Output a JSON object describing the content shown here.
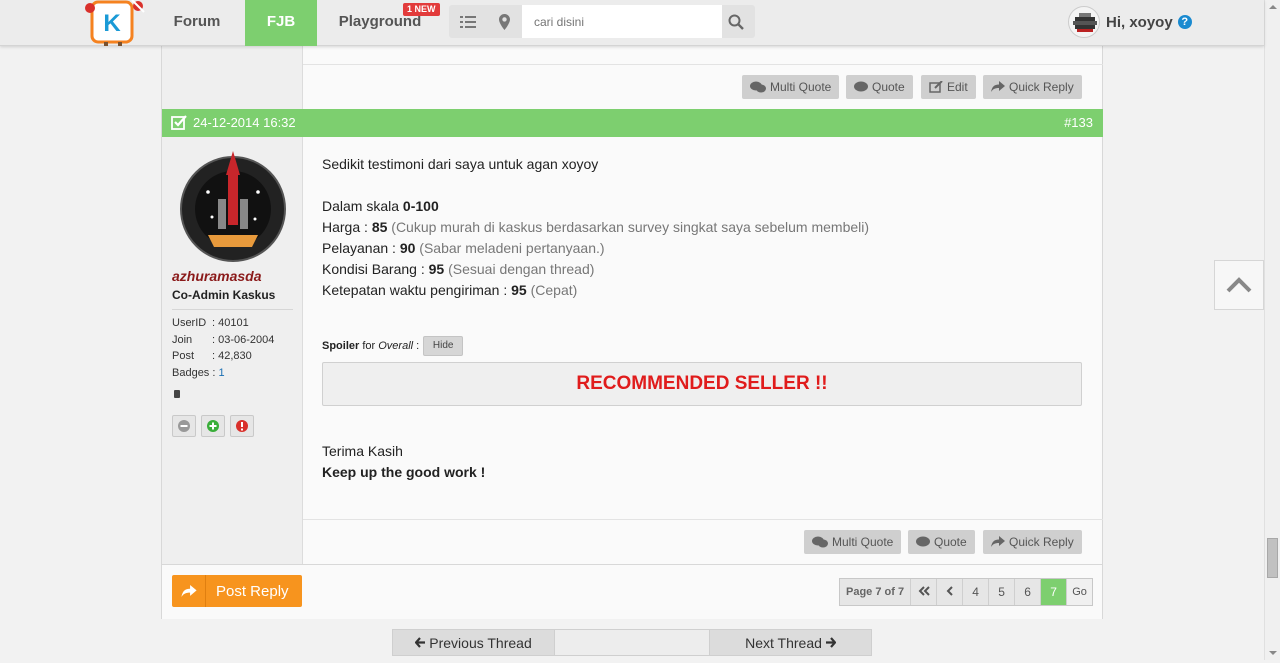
{
  "nav": {
    "forum": "Forum",
    "fjb": "FJB",
    "playground": "Playground",
    "new_badge": "1 NEW"
  },
  "search": {
    "placeholder": "cari disini"
  },
  "user": {
    "greeting": "Hi, xoyoy",
    "help": "?"
  },
  "prev_post": {
    "buttons": {
      "multi_quote": "Multi Quote",
      "quote": "Quote",
      "edit": "Edit",
      "quick_reply": "Quick Reply"
    }
  },
  "post": {
    "date": "24-12-2014 16:32",
    "number": "#133",
    "author": {
      "name": "azhuramasda",
      "rank": "Co-Admin Kaskus",
      "userid_label": "UserID",
      "userid": ": 40101",
      "join_label": "Join",
      "join": ": 03-06-2004",
      "post_label": "Post",
      "post_count": ": 42,830",
      "badges_label": "Badges :",
      "badges": "1"
    },
    "body": {
      "intro": "Sedikit testimoni dari saya untuk agan xoyoy",
      "scale_label": "Dalam skala ",
      "scale_value": "0-100",
      "harga_label": "Harga : ",
      "harga_value": "85",
      "harga_note": " (Cukup murah di kaskus berdasarkan survey singkat saya sebelum membeli)",
      "pelayanan_label": "Pelayanan : ",
      "pelayanan_value": "90",
      "pelayanan_note": " (Sabar meladeni pertanyaan.)",
      "kondisi_label": "Kondisi Barang : ",
      "kondisi_value": "95",
      "kondisi_note": " (Sesuai dengan thread)",
      "waktu_label": "Ketepatan waktu pengiriman : ",
      "waktu_value": "95",
      "waktu_note": " (Cepat)",
      "spoiler_word": "Spoiler",
      "spoiler_for": " for ",
      "spoiler_title": "Overall",
      "spoiler_colon": " :",
      "hide": "Hide",
      "spoiler_content": "RECOMMENDED SELLER !!",
      "thanks": "Terima Kasih",
      "closing": "Keep up the good work !"
    },
    "buttons": {
      "multi_quote": "Multi Quote",
      "quote": "Quote",
      "quick_reply": "Quick Reply"
    }
  },
  "reply": {
    "post_reply": "Post Reply"
  },
  "pagination": {
    "label": "Page 7 of 7",
    "pages": [
      "4",
      "5",
      "6",
      "7"
    ],
    "current": "7",
    "go": "Go"
  },
  "thread_nav": {
    "previous": "Previous Thread",
    "next": "Next Thread"
  },
  "colors": {
    "accent_green": "#7dcf6f",
    "orange": "#f7941e",
    "red": "#e01c1c",
    "username": "#8b1a1a"
  }
}
